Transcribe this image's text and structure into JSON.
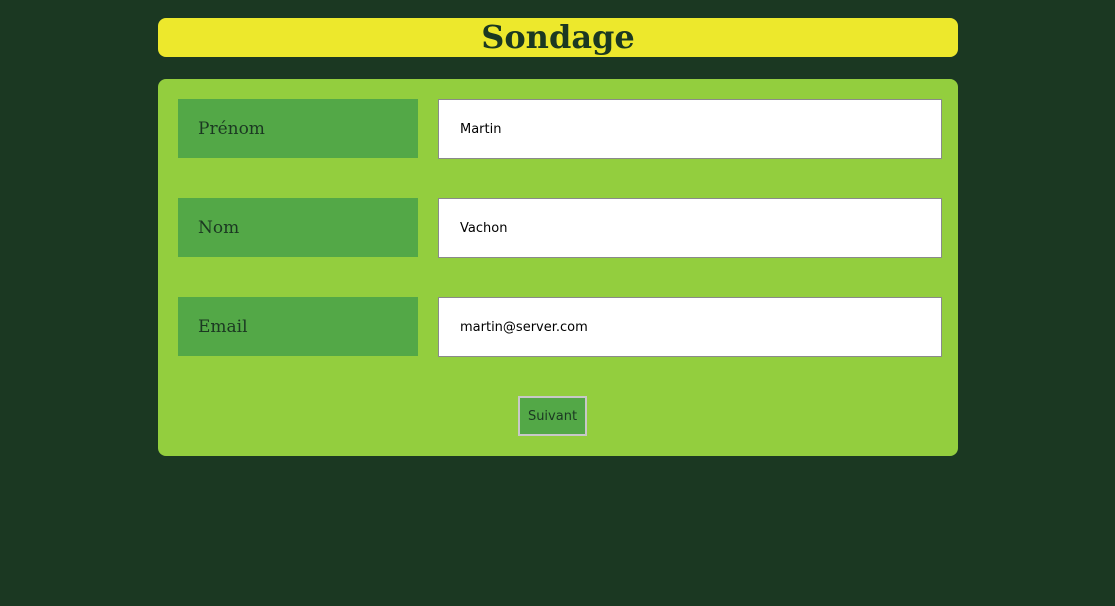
{
  "header": {
    "title": "Sondage"
  },
  "form": {
    "fields": [
      {
        "label": "Prénom",
        "value": "Martin"
      },
      {
        "label": "Nom",
        "value": "Vachon"
      },
      {
        "label": "Email",
        "value": "martin@server.com"
      }
    ],
    "submit_label": "Suivant"
  },
  "colors": {
    "background": "#1b3822",
    "header": "#ede82c",
    "panel": "#93ce3e",
    "label": "#53a847"
  }
}
